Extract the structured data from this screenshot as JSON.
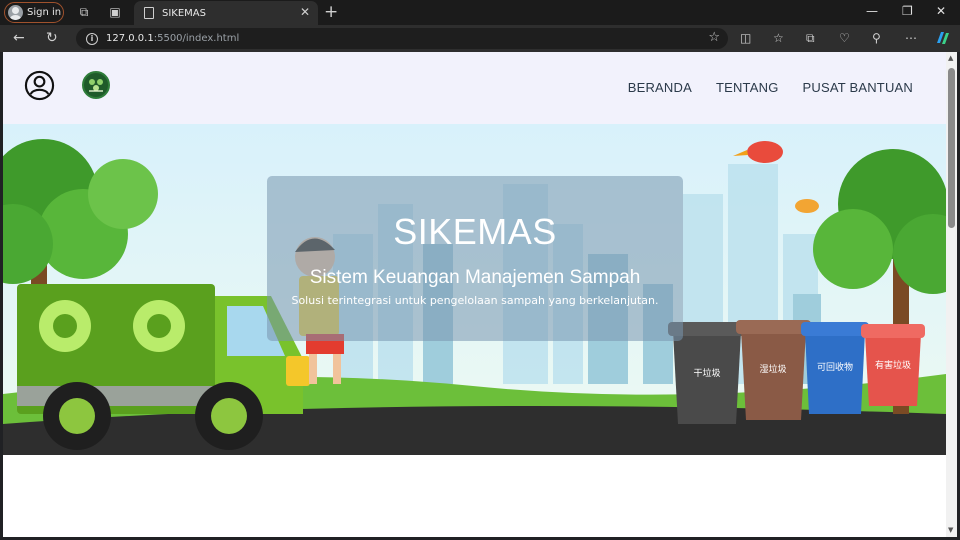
{
  "browser": {
    "signin_label": "Sign in",
    "tab_title": "SIKEMAS",
    "url_host": "127.0.0.1",
    "url_rest": ":5500/index.html"
  },
  "site": {
    "nav": [
      "BERANDA",
      "TENTANG",
      "PUSAT BANTUAN"
    ]
  },
  "hero": {
    "title": "SIKEMAS",
    "subtitle": "Sistem Keuangan Manajemen Sampah",
    "tagline": "Solusi terintegrasi untuk pengelolaan sampah yang berkelanjutan."
  },
  "bins": [
    "干垃圾",
    "湿垃圾",
    "可回收物",
    "有害垃圾"
  ],
  "colors": {
    "header_bg": "#f2f2fc",
    "nav_text": "#2b3a4a",
    "truck_green": "#5aa01e",
    "bin_gray": "#4a4a4a",
    "bin_brown": "#8a5a46",
    "bin_blue": "#2e6fc7",
    "bin_red": "#e5544c"
  }
}
